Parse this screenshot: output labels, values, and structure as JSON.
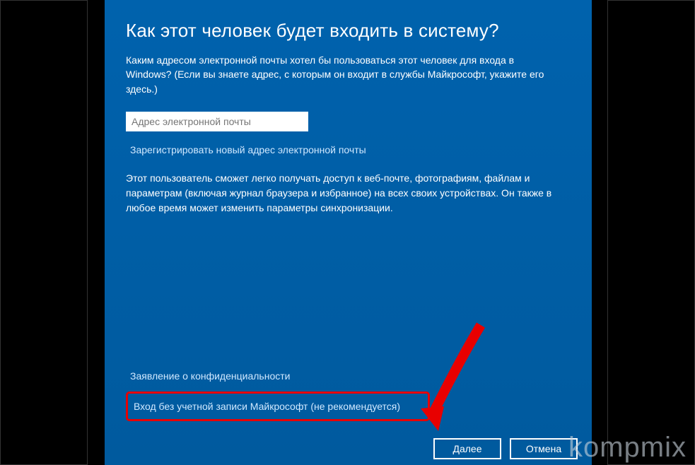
{
  "dialog": {
    "title": "Как этот человек будет входить в систему?",
    "description": "Каким адресом электронной почты хотел бы пользоваться этот человек для входа в Windows? (Если вы знаете адрес, с которым он входит в службы Майкрософт, укажите его здесь.)",
    "email_placeholder": "Адрес электронной почты",
    "register_link": "Зарегистрировать новый адрес электронной почты",
    "info_text": "Этот пользователь сможет легко получать доступ к веб-почте, фотографиям, файлам и параметрам (включая журнал браузера и избранное) на всех своих устройствах. Он также в любое время может изменить параметры синхронизации.",
    "privacy_link": "Заявление о конфиденциальности",
    "no_account_link": "Вход без учетной записи Майкрософт (не рекомендуется)",
    "next_button": "Далее",
    "cancel_button": "Отмена"
  },
  "watermark": "kompmix"
}
